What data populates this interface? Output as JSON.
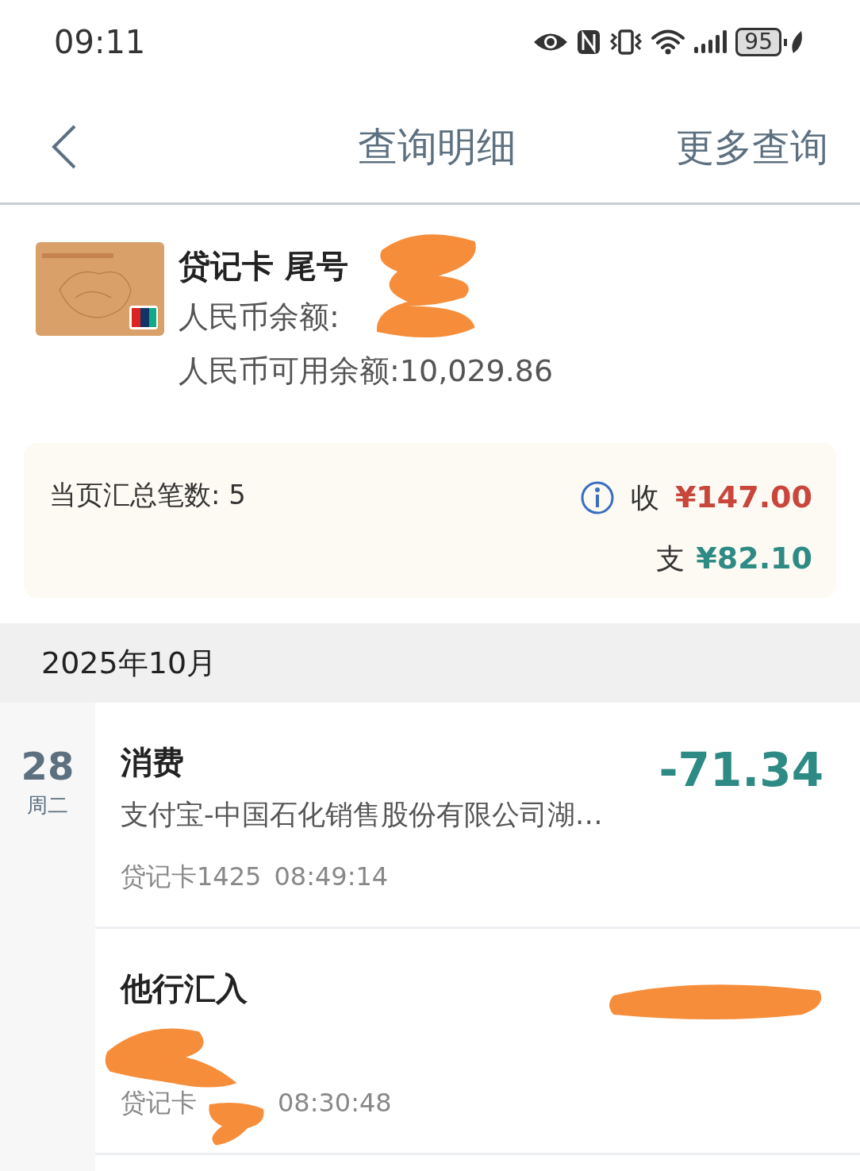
{
  "status_bar": {
    "time": "09:11",
    "battery": "95"
  },
  "header": {
    "title": "查询明细",
    "action": "更多查询"
  },
  "account": {
    "name": "贷记卡 尾号",
    "balance_label": "人民币余额:",
    "balance_redacted": true,
    "available": "人民币可用余额:10,029.86"
  },
  "summary": {
    "count": "当页汇总笔数: 5",
    "income_label": "收",
    "income": "¥147.00",
    "expense_label": "支",
    "expense": "¥82.10"
  },
  "month": "2025年10月",
  "day": {
    "date": "28",
    "weekday": "周二"
  },
  "transactions": [
    {
      "title": "消费",
      "description": "支付宝-中国石化销售股份有限公司湖…",
      "card": "贷记卡1425",
      "time": "08:49:14",
      "amount": "-71.34",
      "redacted": false
    },
    {
      "title": "他行汇入",
      "card": "贷记卡",
      "time": "08:30:48",
      "redacted": true
    }
  ]
}
